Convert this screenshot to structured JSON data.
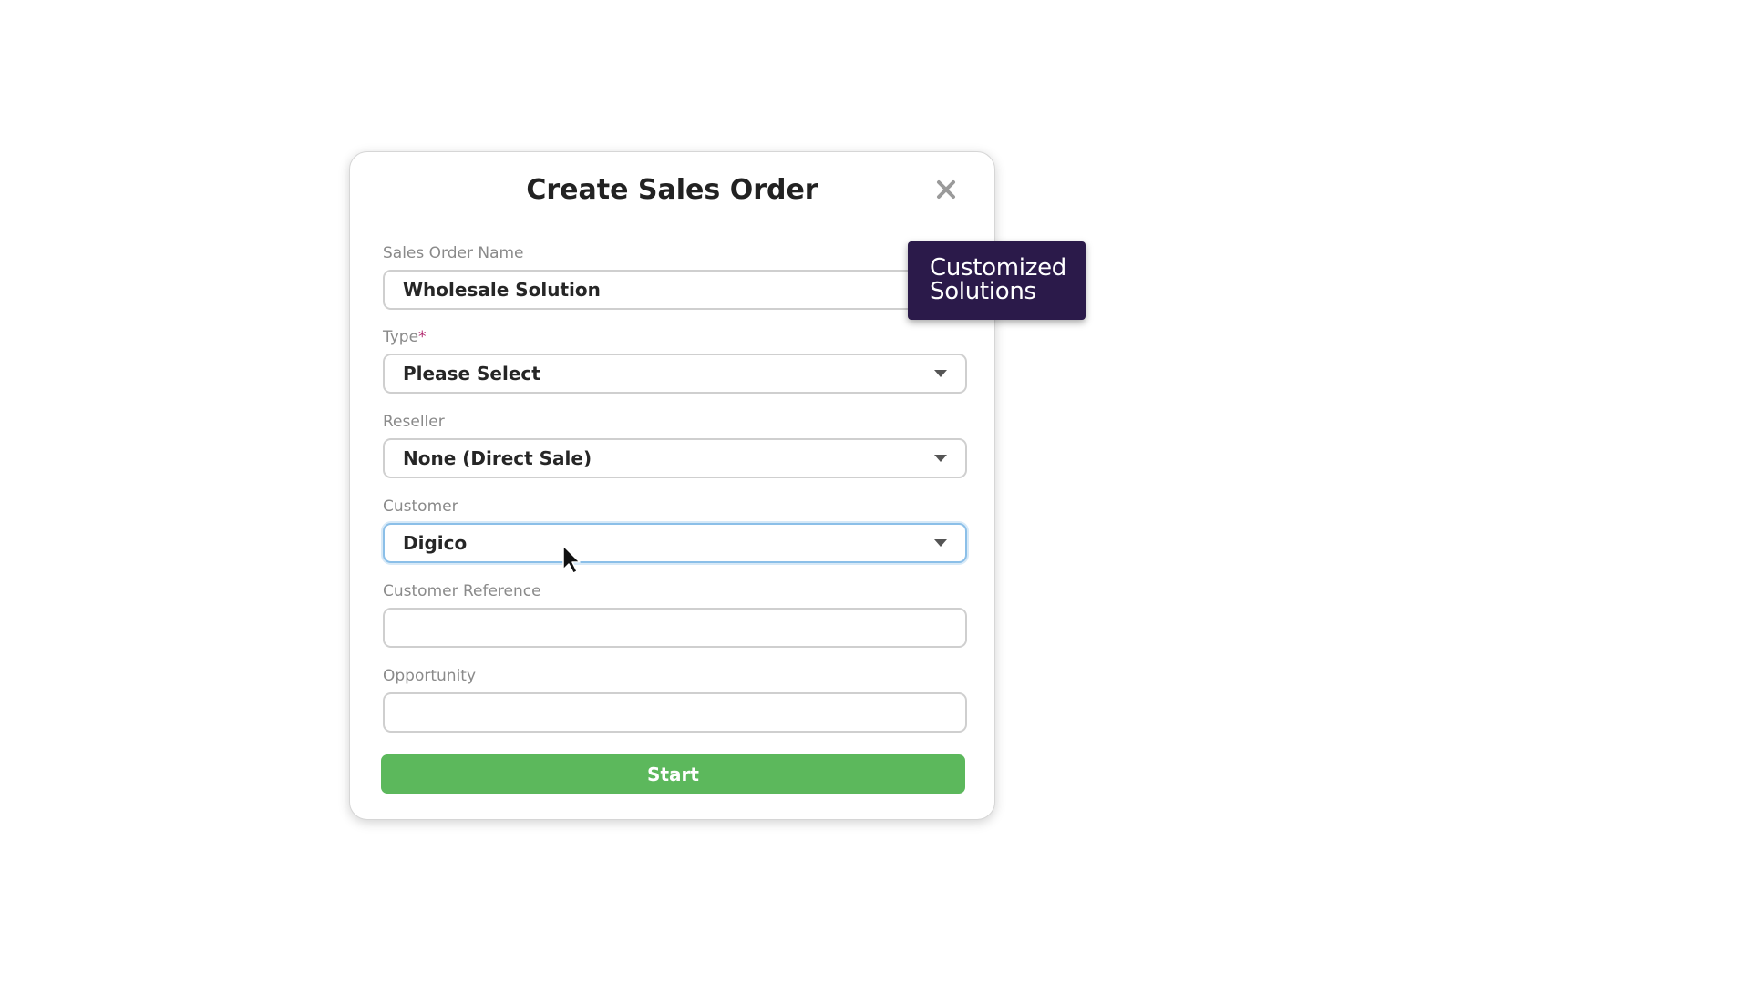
{
  "modal": {
    "title": "Create Sales Order",
    "close_icon": "close-icon"
  },
  "fields": {
    "sales_order_name": {
      "label": "Sales Order Name",
      "value": "Wholesale Solution"
    },
    "type": {
      "label": "Type",
      "required_mark": "*",
      "value": "Please Select"
    },
    "reseller": {
      "label": "Reseller",
      "value": "None (Direct Sale)"
    },
    "customer": {
      "label": "Customer",
      "value": "Digico"
    },
    "customer_reference": {
      "label": "Customer Reference",
      "value": ""
    },
    "opportunity": {
      "label": "Opportunity",
      "value": ""
    }
  },
  "actions": {
    "start_label": "Start"
  },
  "tooltip": {
    "line1": "Customized",
    "line2": "Solutions"
  },
  "colors": {
    "start_button": "#5cb85c",
    "tooltip_bg": "#2b1a4a",
    "required_mark": "#b0246b",
    "focus_border": "#8bbfe8"
  }
}
